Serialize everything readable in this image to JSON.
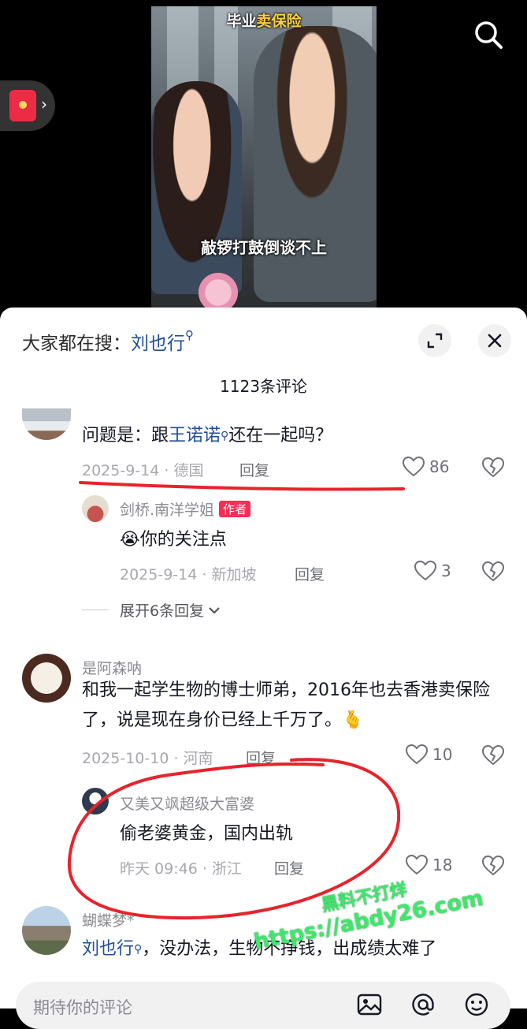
{
  "video": {
    "caption_top_prefix": "毕业",
    "caption_top_highlight": "卖保险",
    "caption_bottom": "敲锣打鼓倒谈不上"
  },
  "sheet": {
    "hot_search_label": "大家都在搜：",
    "hot_search_keyword": "刘也行",
    "comment_count": "1123条评论"
  },
  "comments": [
    {
      "text_prefix": "问题是：跟",
      "text_link": "王诺诺",
      "text_suffix": "还在一起吗？",
      "meta": "2025-9-14 · 德国",
      "reply": "回复",
      "likes": "86"
    },
    {
      "user": "剑桥.南洋学姐",
      "badge": "作者",
      "emoji": "😭",
      "text": "你的关注点",
      "meta": "2025-9-14 · 新加坡",
      "reply": "回复",
      "likes": "3",
      "expand": "展开6条回复"
    },
    {
      "user": "是阿森呐",
      "text": "和我一起学生物的博士师弟，2016年也去香港卖保险了，说是现在身价已经上千万了。",
      "emoji": "🫰",
      "meta": "2025-10-10 · 河南",
      "reply": "回复",
      "likes": "10"
    },
    {
      "user": "又美又飒超级大富婆",
      "text": "偷老婆黄金，国内出轨",
      "meta": "昨天 09:46 · 浙江",
      "reply": "回复",
      "likes": "18"
    },
    {
      "user": "蝴蝶梦*",
      "text_link": "刘也行",
      "text_suffix": "，没办法，生物不挣钱，出成绩太难了"
    }
  ],
  "input": {
    "placeholder": "期待你的评论"
  },
  "watermark": {
    "line1": "黑料不打烊",
    "line2": "https://abdy26.com"
  },
  "colors": {
    "accent_red": "#fe2c55",
    "annotation_red": "#e8232b",
    "link_blue": "#1f4e9c",
    "watermark_green": "#3ee86a"
  }
}
